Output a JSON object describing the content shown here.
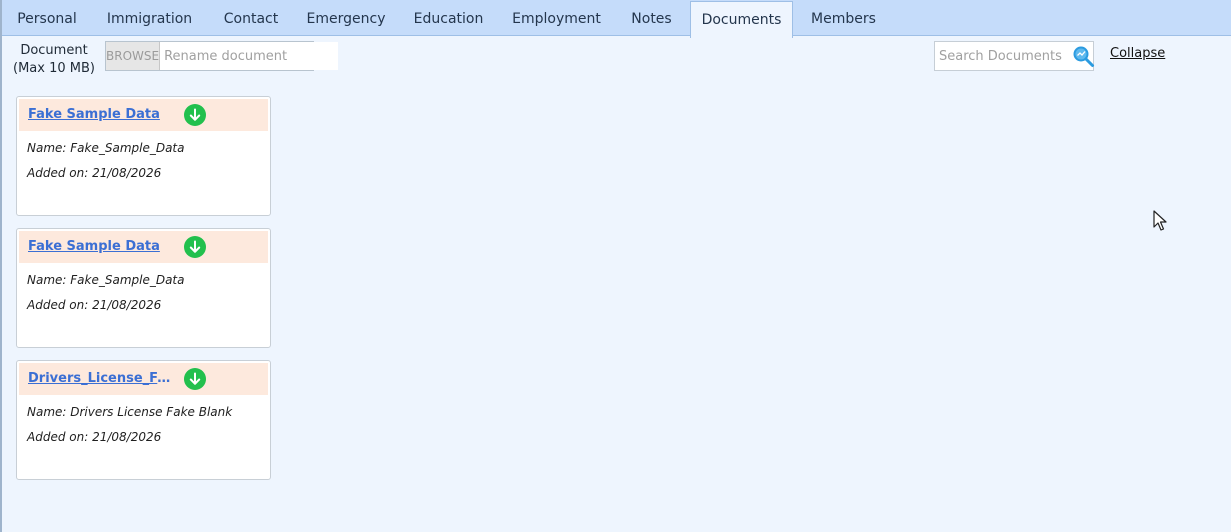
{
  "tabs": [
    {
      "label": "Personal",
      "active": false
    },
    {
      "label": "Immigration",
      "active": false
    },
    {
      "label": "Contact",
      "active": false
    },
    {
      "label": "Emergency",
      "active": false
    },
    {
      "label": "Education",
      "active": false
    },
    {
      "label": "Employment",
      "active": false
    },
    {
      "label": "Notes",
      "active": false
    },
    {
      "label": "Documents",
      "active": true
    },
    {
      "label": "Members",
      "active": false
    }
  ],
  "upload": {
    "label_line1": "Document",
    "label_line2": "(Max 10 MB)",
    "browse_label": "BROWSE",
    "rename_placeholder": "Rename document",
    "rename_value": ""
  },
  "search": {
    "placeholder": "Search Documents",
    "value": ""
  },
  "collapse_label": "Collapse",
  "documents": [
    {
      "title": "Fake Sample Data",
      "name_line": "Name: Fake_Sample_Data",
      "added_line": "Added on: 21/08/2026"
    },
    {
      "title": "Fake Sample Data",
      "name_line": "Name: Fake_Sample_Data",
      "added_line": "Added on: 21/08/2026"
    },
    {
      "title": "Drivers_License_Fake...",
      "name_line": "Name: Drivers License Fake Blank",
      "added_line": "Added on: 21/08/2026"
    }
  ],
  "colors": {
    "tabbar_bg": "#c5dcfa",
    "page_bg": "#eef5fe",
    "card_header_bg": "#fde9dd",
    "link_blue": "#3b6fd4",
    "download_green": "#22c04d",
    "search_icon_blue": "#2b9be0"
  },
  "icons": {
    "search": "search-icon",
    "download": "download-icon",
    "cursor": "mouse-pointer-icon"
  }
}
